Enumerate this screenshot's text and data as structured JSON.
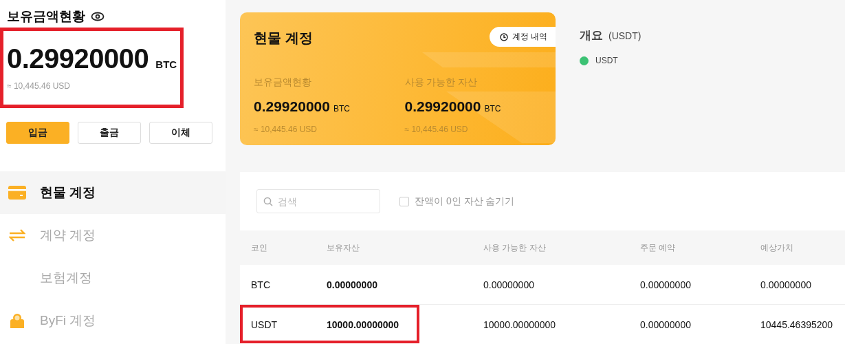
{
  "balance": {
    "title": "보유금액현황",
    "amount": "0.29920000",
    "unit": "BTC",
    "approx": "≈ 10,445.46 USD",
    "highlighted": true
  },
  "actions": [
    {
      "label": "입금",
      "primary": true
    },
    {
      "label": "출금",
      "primary": false
    },
    {
      "label": "이체",
      "primary": false
    }
  ],
  "sidebar": {
    "items": [
      {
        "label": "현물 계정",
        "selected": true
      },
      {
        "label": "계약 계정",
        "selected": false
      },
      {
        "label": "보험계정",
        "selected": false
      },
      {
        "label": "ByFi 계정",
        "selected": false
      }
    ]
  },
  "account_card": {
    "title": "현물 계정",
    "history_button": "계정 내역",
    "stats": [
      {
        "label": "보유금액현황",
        "amount": "0.29920000",
        "unit": "BTC",
        "approx": "≈ 10,445.46 USD"
      },
      {
        "label": "사용 가능한 자산",
        "amount": "0.29920000",
        "unit": "BTC",
        "approx": "≈ 10,445.46 USD"
      }
    ]
  },
  "overview": {
    "title": "개요",
    "unit": "(USDT)",
    "legend": [
      {
        "label": "USDT",
        "color": "#3cc274"
      }
    ]
  },
  "filters": {
    "search_placeholder": "검색",
    "hide_zero": {
      "label": "잔액이 0인 자산 숨기기",
      "checked": false
    }
  },
  "table": {
    "columns": [
      "코인",
      "보유자산",
      "사용 가능한 자산",
      "주문 예약",
      "예상가치"
    ],
    "rows": [
      {
        "cells": [
          "BTC",
          "0.00000000",
          "0.00000000",
          "0.00000000",
          "0.00000000"
        ],
        "highlighted": false
      },
      {
        "cells": [
          "USDT",
          "10000.00000000",
          "10000.00000000",
          "0.00000000",
          "10445.46395200"
        ],
        "highlighted": true
      }
    ]
  }
}
